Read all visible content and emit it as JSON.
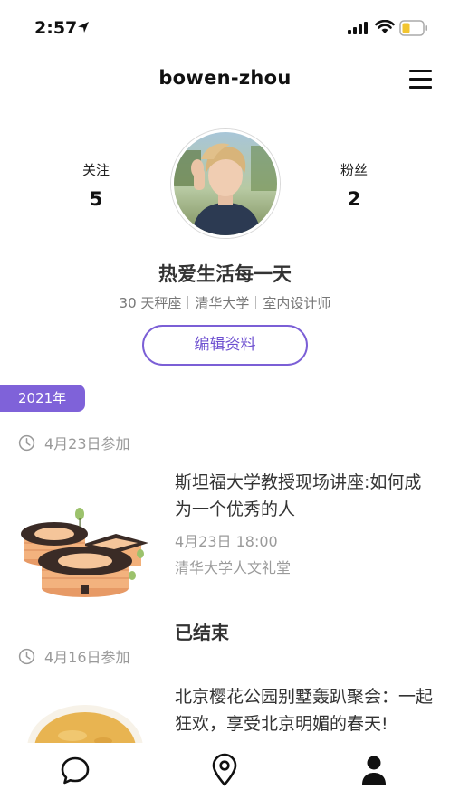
{
  "status_bar": {
    "time": "2:57"
  },
  "header": {
    "title": "bowen-zhou"
  },
  "profile": {
    "following_label": "关注",
    "following_count": "5",
    "fans_label": "粉丝",
    "fans_count": "2",
    "motto": "热爱生活每一天",
    "meta": [
      "30 天秤座",
      "清华大学",
      "室内设计师"
    ],
    "edit_button": "编辑资料"
  },
  "timeline": {
    "year": "2021年",
    "groups": [
      {
        "joined_date": "4月23日参加",
        "event": {
          "title": "斯坦福大学教授现场讲座:如何成为一个优秀的人",
          "time": "4月23日 18:00",
          "place": "清华大学人文礼堂",
          "status": "已结束"
        }
      },
      {
        "joined_date": "4月16日参加",
        "event": {
          "title": "北京樱花公园别墅轰趴聚会：一起狂欢，享受北京明媚的春天!"
        }
      }
    ]
  },
  "tab_bar": {
    "tabs": [
      {
        "icon": "chat-bubble-icon"
      },
      {
        "icon": "location-pin-icon"
      },
      {
        "icon": "person-icon",
        "active": true
      }
    ]
  },
  "colors": {
    "accent": "#7f62d9",
    "text_primary": "#333333",
    "text_secondary": "#9a9a9a"
  }
}
